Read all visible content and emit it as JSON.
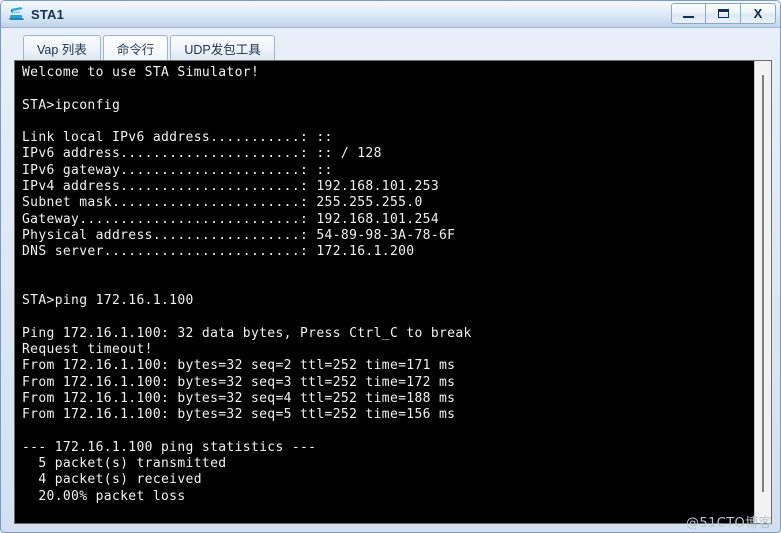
{
  "window": {
    "title": "STA1",
    "icon": "sta-device-icon",
    "controls": {
      "minimize_label": "—",
      "maximize_label": "❐",
      "close_label": "X",
      "minimize_name": "minimize",
      "maximize_name": "maximize",
      "close_name": "close"
    }
  },
  "tabs": [
    {
      "label": "Vap 列表",
      "active": false
    },
    {
      "label": "命令行",
      "active": true
    },
    {
      "label": "UDP发包工具",
      "active": false
    }
  ],
  "terminal": {
    "lines": [
      "Welcome to use STA Simulator!",
      "",
      "STA>ipconfig",
      "",
      "Link local IPv6 address...........: ::",
      "IPv6 address......................: :: / 128",
      "IPv6 gateway......................: ::",
      "IPv4 address......................: 192.168.101.253",
      "Subnet mask.......................: 255.255.255.0",
      "Gateway...........................: 192.168.101.254",
      "Physical address..................: 54-89-98-3A-78-6F",
      "DNS server........................: 172.16.1.200",
      "",
      "",
      "STA>ping 172.16.1.100",
      "",
      "Ping 172.16.1.100: 32 data bytes, Press Ctrl_C to break",
      "Request timeout!",
      "From 172.16.1.100: bytes=32 seq=2 ttl=252 time=171 ms",
      "From 172.16.1.100: bytes=32 seq=3 ttl=252 time=172 ms",
      "From 172.16.1.100: bytes=32 seq=4 ttl=252 time=188 ms",
      "From 172.16.1.100: bytes=32 seq=5 ttl=252 time=156 ms",
      "",
      "--- 172.16.1.100 ping statistics ---",
      "  5 packet(s) transmitted",
      "  4 packet(s) received",
      "  20.00% packet loss"
    ]
  },
  "watermark": {
    "text": "@51CTO博客"
  },
  "colors": {
    "terminal_bg": "#000000",
    "terminal_fg": "#f2f2f2",
    "frame_border": "#7a9bc0",
    "title_text": "#14315c",
    "watermark": "#b9c3cd"
  }
}
